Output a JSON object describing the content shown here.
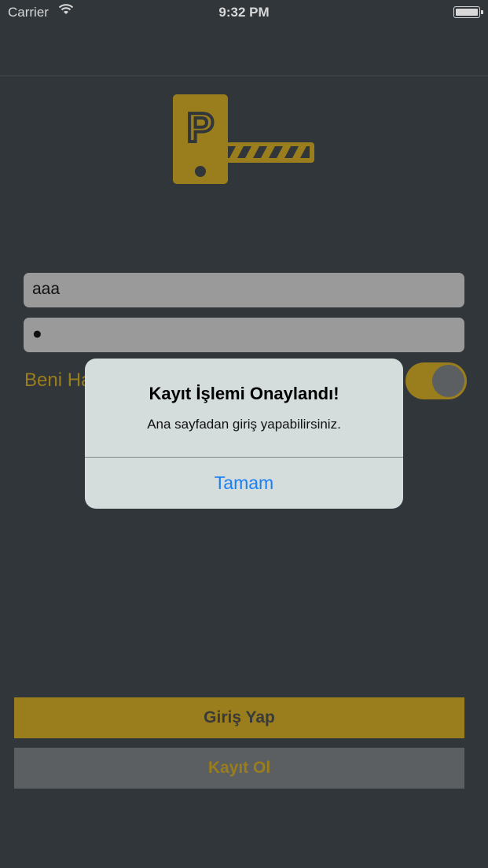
{
  "status_bar": {
    "carrier": "Carrier",
    "wifi_icon": "wifi-icon",
    "time": "9:32 PM",
    "battery_icon": "battery-icon"
  },
  "logo": {
    "icon": "parking-barrier-logo",
    "letter": "P",
    "color": "#9a7d1c"
  },
  "form": {
    "username_value": "aaa",
    "password_value": "●",
    "remember_label": "Beni Ha",
    "remember_toggle_on": true
  },
  "buttons": {
    "login_label": "Giriş Yap",
    "register_label": "Kayıt Ol"
  },
  "alert": {
    "title": "Kayıt İşlemi Onaylandı!",
    "message": "Ana sayfadan giriş yapabilirsiniz.",
    "button_label": "Tamam",
    "button_color": "#1a7ff5"
  },
  "colors": {
    "background": "#30363a",
    "accent": "#9a7d1c",
    "field": "#9a9a9a",
    "secondary_button": "#5b5f62"
  }
}
